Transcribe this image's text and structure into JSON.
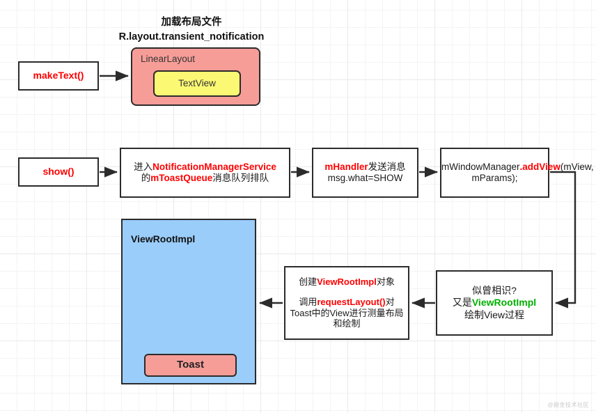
{
  "diagram": {
    "title_line1": "加载布局文件",
    "title_line2": "R.layout.transient_notification",
    "watermark": "@掘金技术社区",
    "colors": {
      "accent_red": "#ff0000",
      "accent_green": "#00b000",
      "salmon": "#f79d98",
      "yellow": "#fbf873",
      "blue": "#9acdfa",
      "stroke": "#2b2b2b",
      "grid": "#e9e9e9"
    },
    "nodes": {
      "make_text": "makeText()",
      "linear_layout": "LinearLayout",
      "text_view": "TextView",
      "show": "show()",
      "nms": {
        "p1": "进入",
        "p2": "NotificationManagerService",
        "p3": "的",
        "p4": "mToastQueue",
        "p5": "消息队列排队"
      },
      "handler": {
        "p1": "mHandler",
        "p2": "发送消息",
        "p3": "msg.what=SHOW"
      },
      "window_manager": {
        "p1": "mWindowManager",
        "p2": ".addView",
        "p3": "(mView, mParams);"
      },
      "view_root_impl": "ViewRootImpl",
      "toast": "Toast",
      "create_vri": {
        "p1": "创建",
        "p2": "ViewRootImpl",
        "p3": "对象",
        "p4": "调用",
        "p5": "requestLayout()",
        "p6": "对Toast中的View进行测量布局和绘制"
      },
      "again_vri": {
        "p1": "似曾相识?",
        "p2": "又是",
        "p3": "ViewRootImpl",
        "p4": "绘制View过程"
      }
    }
  }
}
